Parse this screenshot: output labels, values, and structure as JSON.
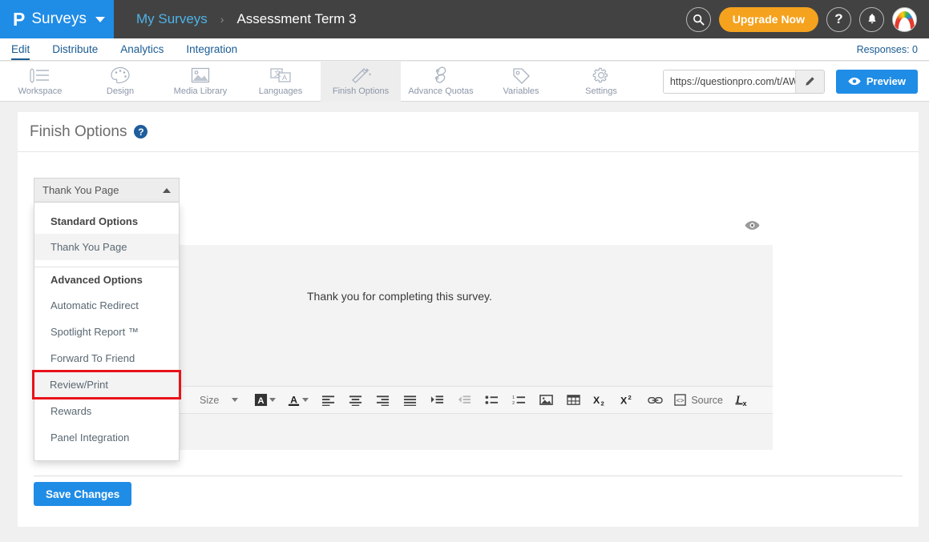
{
  "header": {
    "brand_logo": "P",
    "brand_text": "Surveys",
    "breadcrumb_root": "My Surveys",
    "breadcrumb_sep": "›",
    "breadcrumb_current": "Assessment Term 3",
    "search_icon": "search-icon",
    "upgrade_label": "Upgrade Now",
    "help_label": "?",
    "notifications_icon": "bell-icon",
    "avatar_icon": "user-avatar"
  },
  "nav": {
    "tabs": [
      {
        "label": "Edit",
        "active": true
      },
      {
        "label": "Distribute",
        "active": false
      },
      {
        "label": "Analytics",
        "active": false
      },
      {
        "label": "Integration",
        "active": false
      }
    ],
    "responses": "Responses: 0"
  },
  "toolbar": {
    "items": [
      {
        "label": "Workspace",
        "icon": "workspace-icon",
        "selected": false
      },
      {
        "label": "Design",
        "icon": "palette-icon",
        "selected": false
      },
      {
        "label": "Media Library",
        "icon": "image-icon",
        "selected": false
      },
      {
        "label": "Languages",
        "icon": "languages-icon",
        "selected": false
      },
      {
        "label": "Finish Options",
        "icon": "magic-wand-icon",
        "selected": true
      },
      {
        "label": "Advance Quotas",
        "icon": "links-icon",
        "selected": false
      },
      {
        "label": "Variables",
        "icon": "tag-icon",
        "selected": false
      },
      {
        "label": "Settings",
        "icon": "gear-icon",
        "selected": false
      }
    ],
    "survey_url": "https://questionpro.com/t/AW",
    "url_edit_icon": "pencil-icon",
    "preview_label": "Preview",
    "preview_icon": "eye-icon"
  },
  "card": {
    "title": "Finish Options",
    "help_badge": "?"
  },
  "select": {
    "value": "Thank You Page",
    "caret": "chevron-up-icon"
  },
  "dropdown": {
    "groups": [
      {
        "header": "Standard Options",
        "items": [
          {
            "label": "Thank You Page",
            "state": "highlighted"
          }
        ]
      },
      {
        "header": "Advanced Options",
        "items": [
          {
            "label": "Automatic Redirect",
            "state": "normal"
          },
          {
            "label": "Spotlight Report ™",
            "state": "normal"
          },
          {
            "label": "Forward To Friend",
            "state": "normal"
          },
          {
            "label": "Review/Print",
            "state": "target"
          },
          {
            "label": "Rewards",
            "state": "normal"
          },
          {
            "label": "Panel Integration",
            "state": "normal"
          }
        ]
      }
    ],
    "highlight_color": "#e8121a"
  },
  "editor": {
    "preview_toggle_icon": "eye-icon",
    "content_text": "Thank you for completing this survey.",
    "toolbar_buttons": [
      {
        "name": "font-size-dropdown",
        "label": "Size"
      },
      {
        "name": "background-color-picker",
        "label": ""
      },
      {
        "name": "text-color-picker",
        "label": ""
      },
      {
        "name": "align-left-button",
        "label": ""
      },
      {
        "name": "align-center-button",
        "label": ""
      },
      {
        "name": "align-right-button",
        "label": ""
      },
      {
        "name": "align-justify-button",
        "label": ""
      },
      {
        "name": "indent-increase-button",
        "label": ""
      },
      {
        "name": "indent-decrease-button",
        "label": ""
      },
      {
        "name": "bulleted-list-button",
        "label": ""
      },
      {
        "name": "numbered-list-button",
        "label": ""
      },
      {
        "name": "insert-image-button",
        "label": ""
      },
      {
        "name": "insert-table-button",
        "label": ""
      },
      {
        "name": "subscript-button",
        "label": ""
      },
      {
        "name": "superscript-button",
        "label": ""
      },
      {
        "name": "insert-link-button",
        "label": ""
      },
      {
        "name": "source-button",
        "label": "Source"
      },
      {
        "name": "remove-format-button",
        "label": ""
      }
    ],
    "source_label": "Source"
  },
  "footer": {
    "save_label": "Save Changes"
  },
  "colors": {
    "brand_blue": "#1f8ce6",
    "header_dark": "#424242",
    "upgrade_orange": "#f5a21e",
    "nav_link": "#1a5b93",
    "highlight_red": "#e8121a"
  }
}
